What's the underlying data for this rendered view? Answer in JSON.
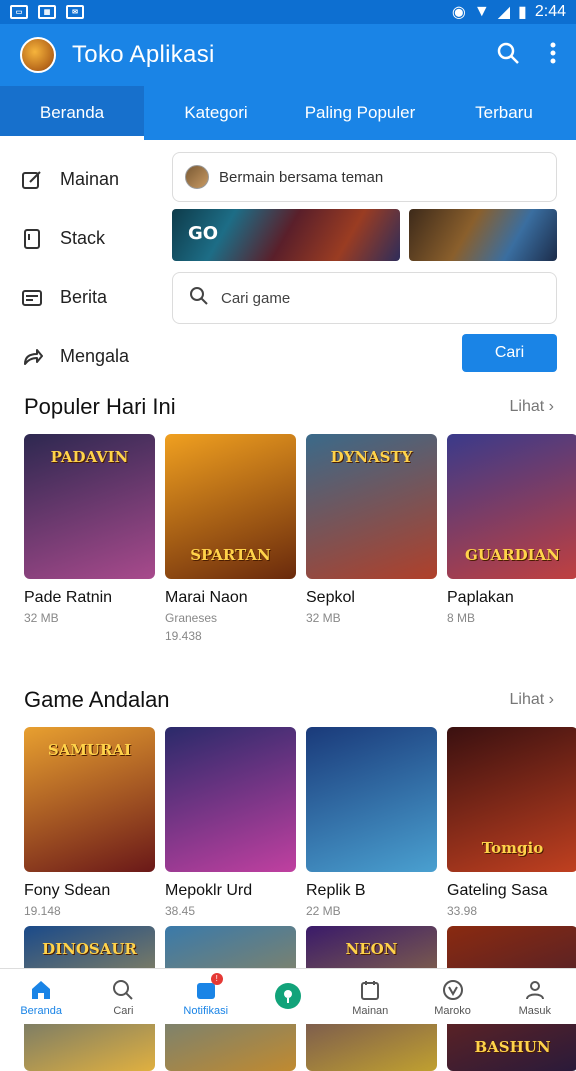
{
  "statusbar": {
    "time": "2:44"
  },
  "app": {
    "title": "Toko Aplikasi"
  },
  "tabs": [
    {
      "label": "Beranda"
    },
    {
      "label": "Kategori"
    },
    {
      "label": "Paling Populer"
    },
    {
      "label": "Terbaru"
    }
  ],
  "menu": [
    {
      "label": "Mainan",
      "icon": "edit-icon"
    },
    {
      "label": "Stack",
      "icon": "bookmark-icon"
    },
    {
      "label": "Berita",
      "icon": "card-icon"
    },
    {
      "label": "Mengala",
      "icon": "share-icon"
    }
  ],
  "recent": {
    "text": "Bermain bersama teman"
  },
  "search": {
    "placeholder": "Cari game"
  },
  "button": {
    "label": "Cari"
  },
  "banner": {
    "text": "GO"
  },
  "section1": {
    "title": "Populer Hari Ini",
    "more": "Lihat",
    "games": [
      {
        "name": "Pade Ratnin",
        "sub": "32 MB",
        "sub2": "",
        "art": "PADAVIN",
        "c1": "#2d2850",
        "c2": "#a84a8c"
      },
      {
        "name": "Marai Naon",
        "sub": "Graneses",
        "sub2": "19.438",
        "art": "SPARTAN",
        "c1": "#f0a020",
        "c2": "#6a2a0c"
      },
      {
        "name": "Sepkol",
        "sub": "32 MB",
        "sub2": "",
        "art": "DYNASTY",
        "c1": "#3a6a8a",
        "c2": "#b0402a"
      },
      {
        "name": "Paplakan",
        "sub": "8 MB",
        "sub2": "",
        "art": "GUARDIAN",
        "c1": "#3a3a8a",
        "c2": "#c04040"
      }
    ]
  },
  "section2": {
    "title": "Game Andalan",
    "more": "Lihat",
    "games": [
      {
        "name": "Fony Sdean",
        "sub": "19.148",
        "art": "SAMURAI",
        "c1": "#e8a030",
        "c2": "#6a1818"
      },
      {
        "name": "Mepoklr Urd",
        "sub": "38.45",
        "art": "",
        "c1": "#2a2a6a",
        "c2": "#c040a0"
      },
      {
        "name": "Replik B",
        "sub": "22 MB",
        "art": "",
        "c1": "#1a3a7a",
        "c2": "#4aa0d0"
      },
      {
        "name": "Gateling Sasa",
        "sub": "33.98",
        "art": "Tomgio",
        "c1": "#3a1010",
        "c2": "#c04020"
      }
    ]
  },
  "section3": {
    "games": [
      {
        "art": "DINOSAUR",
        "c1": "#1a4a8a",
        "c2": "#e0b040"
      },
      {
        "art": "",
        "c1": "#3a7aaa",
        "c2": "#c08a30"
      },
      {
        "art": "NEON",
        "c1": "#3a1a6a",
        "c2": "#c0a030"
      },
      {
        "art": "BASHUN",
        "c1": "#8a2a10",
        "c2": "#2a1a3a"
      }
    ]
  },
  "bottomnav": [
    {
      "label": "Beranda",
      "icon": "home-icon"
    },
    {
      "label": "Cari",
      "icon": "search-icon"
    },
    {
      "label": "Notifikasi",
      "icon": "notification-icon"
    },
    {
      "label": "",
      "icon": "pin-icon"
    },
    {
      "label": "Mainan",
      "icon": "calendar-icon"
    },
    {
      "label": "Maroko",
      "icon": "location-icon"
    },
    {
      "label": "Masuk",
      "icon": "profile-icon"
    }
  ]
}
